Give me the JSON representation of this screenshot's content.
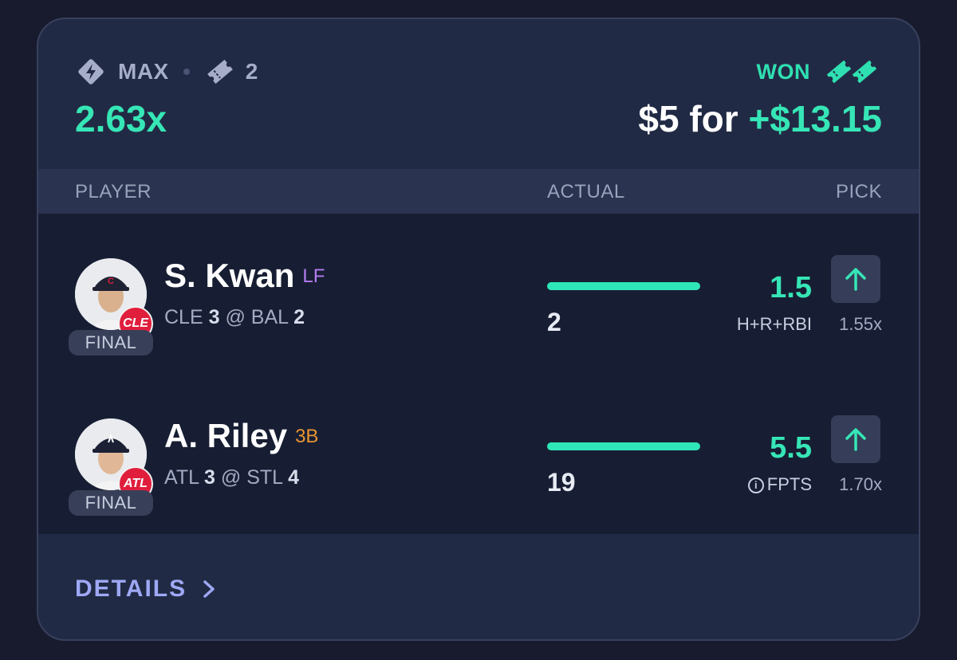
{
  "header": {
    "mode_label": "MAX",
    "entry_count": "2",
    "multiplier": "2.63x",
    "status": "WON",
    "wager": "$5 for",
    "winnings": "+$13.15"
  },
  "columns": {
    "player": "PLAYER",
    "actual": "ACTUAL",
    "pick": "PICK"
  },
  "picks": [
    {
      "name": "S. Kwan",
      "position": "LF",
      "team_abbr": "CLE",
      "game_team": "CLE",
      "game_team_score": "3",
      "game_sep": "@",
      "game_opp": "BAL",
      "game_opp_score": "2",
      "game_status": "FINAL",
      "actual": "2",
      "line": "1.5",
      "stat": "H+R+RBI",
      "pick_multiplier": "1.55x",
      "direction": "up"
    },
    {
      "name": "A. Riley",
      "position": "3B",
      "team_abbr": "ATL",
      "game_team": "ATL",
      "game_team_score": "3",
      "game_sep": "@",
      "game_opp": "STL",
      "game_opp_score": "4",
      "game_status": "FINAL",
      "actual": "19",
      "line": "5.5",
      "stat": "FPTS",
      "pick_multiplier": "1.70x",
      "direction": "up"
    }
  ],
  "footer": {
    "details_label": "DETAILS"
  },
  "colors": {
    "accent_green": "#36e6b6",
    "details_purple": "#9ea8f5",
    "position_lf": "#b37cf0",
    "position_3b": "#e99533",
    "cle_badge": "#e01e3c"
  }
}
